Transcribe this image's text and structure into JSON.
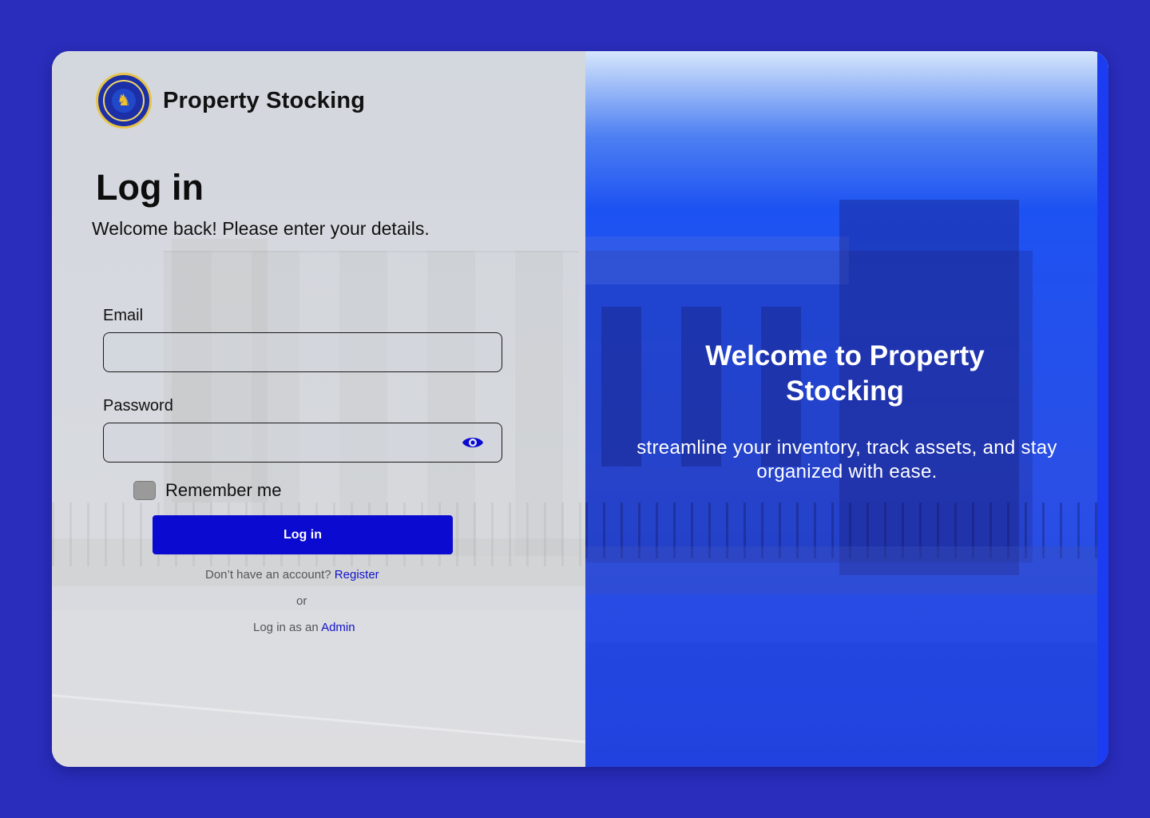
{
  "brand": {
    "name": "Property Stocking",
    "logo_icon": "university-seal-icon"
  },
  "login": {
    "title": "Log in",
    "subtitle": "Welcome back! Please enter your details.",
    "email_label": "Email",
    "email_value": "",
    "password_label": "Password",
    "password_value": "",
    "password_toggle_icon": "eye-icon",
    "remember_label": "Remember me",
    "remember_checked": false,
    "submit_label": "Log in",
    "register_prompt": "Don’t have an account?",
    "register_link": "Register",
    "or_text": "or",
    "admin_prompt": "Log in as an",
    "admin_link": "Admin"
  },
  "hero": {
    "heading": "Welcome to Property Stocking",
    "tagline": "streamline your inventory, track assets, and stay organized with ease."
  },
  "colors": {
    "page_background": "#2a2dbb",
    "primary_button": "#0a0ad0",
    "link": "#1212c8",
    "hero_blue": "#1d52f2"
  }
}
